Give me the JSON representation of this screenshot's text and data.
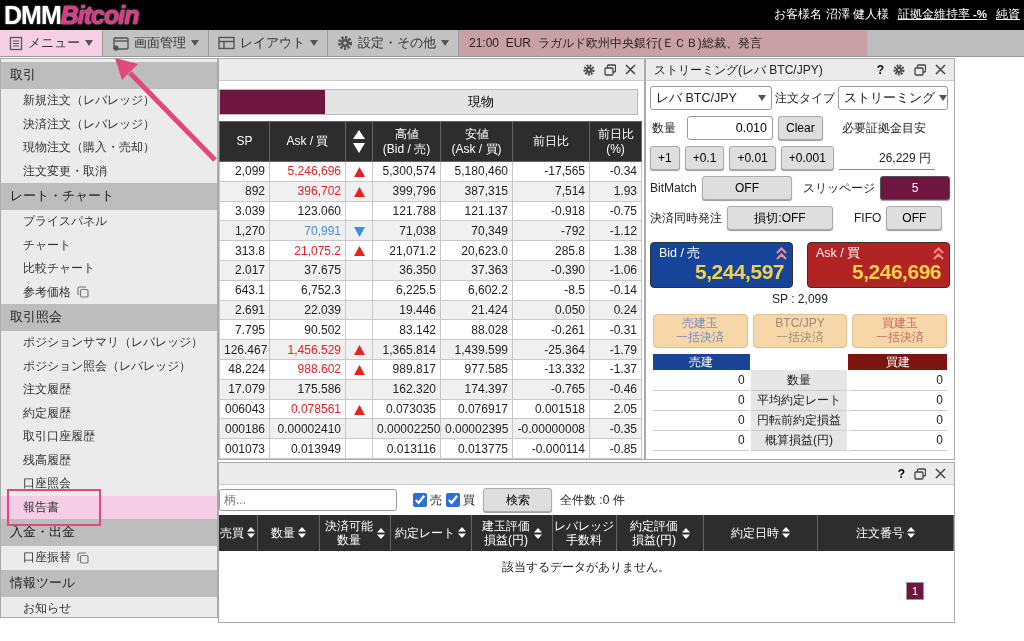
{
  "header": {
    "logo": {
      "main": "DMM",
      "accent": "Bitcoin"
    },
    "customer": "お客様名 沼澤 健人様",
    "links": [
      "証拠金維持率 **-%**",
      "純資"
    ]
  },
  "toolbar": {
    "menus": [
      {
        "label": "メニュー",
        "kind": "list",
        "selected": true
      },
      {
        "label": "画面管理",
        "kind": "window",
        "selected": false
      },
      {
        "label": "レイアウト",
        "kind": "layout",
        "selected": false
      },
      {
        "label": "設定・その他",
        "kind": "gear",
        "selected": false
      }
    ],
    "news": "21:00  EUR  ラガルド欧州中央銀行(ＥＣＢ)総裁、発言"
  },
  "menu": {
    "sections": [
      {
        "title": "取引",
        "items": [
          {
            "label": "新規注文（レバレッジ）",
            "external": false,
            "selected": false,
            "annotated": false
          },
          {
            "label": "決済注文（レバレッジ）",
            "external": false,
            "selected": false,
            "annotated": false
          },
          {
            "label": "現物注文（購入・売却）",
            "external": false,
            "selected": false,
            "annotated": false
          },
          {
            "label": "注文変更・取消",
            "external": false,
            "selected": false,
            "annotated": false
          }
        ]
      },
      {
        "title": "レート・チャート",
        "items": [
          {
            "label": "プライスパネル",
            "external": false,
            "selected": false,
            "annotated": false
          },
          {
            "label": "チャート",
            "external": false,
            "selected": false,
            "annotated": false
          },
          {
            "label": "比較チャート",
            "external": false,
            "selected": false,
            "annotated": false
          },
          {
            "label": "参考価格",
            "external": true,
            "selected": false,
            "annotated": false
          }
        ]
      },
      {
        "title": "取引照会",
        "items": [
          {
            "label": "ポジションサマリ（レバレッジ）",
            "external": false,
            "selected": false,
            "annotated": false
          },
          {
            "label": "ポジション照会（レバレッジ）",
            "external": false,
            "selected": false,
            "annotated": false
          },
          {
            "label": "注文履歴",
            "external": false,
            "selected": false,
            "annotated": false
          },
          {
            "label": "約定履歴",
            "external": false,
            "selected": false,
            "annotated": false
          },
          {
            "label": "取引口座履歴",
            "external": false,
            "selected": false,
            "annotated": false
          },
          {
            "label": "残高履歴",
            "external": false,
            "selected": false,
            "annotated": false
          },
          {
            "label": "口座照会",
            "external": false,
            "selected": false,
            "annotated": false
          },
          {
            "label": "報告書",
            "external": false,
            "selected": true,
            "annotated": true
          }
        ]
      },
      {
        "title": "入金・出金",
        "items": [
          {
            "label": "口座振替",
            "external": true,
            "selected": false,
            "annotated": false
          }
        ]
      },
      {
        "title": "情報ツール",
        "items": [
          {
            "label": "お知らせ",
            "external": false,
            "selected": false,
            "annotated": false
          }
        ]
      }
    ]
  },
  "rate_panel": {
    "tabs": [
      {
        "selected": true
      },
      {
        "label": "現物",
        "selected": false
      }
    ],
    "columns": [
      "SP",
      "Ask / 買",
      "高値\n(Bid / 売)",
      "安値\n(Ask / 買)",
      "前日比",
      "前日比\n(%)"
    ],
    "rows": [
      {
        "sp": "2,099",
        "ask": "5,246,696",
        "kind": "up",
        "high": "5,300,574",
        "low": "5,180,460",
        "change": "-17,565",
        "pct": "-0.34"
      },
      {
        "sp": "892",
        "ask": "396,702",
        "kind": "up",
        "high": "399,796",
        "low": "387,315",
        "change": "7,514",
        "pct": "1.93"
      },
      {
        "sp": "3.039",
        "ask": "123.060",
        "kind": "flat",
        "high": "121.788",
        "low": "121.137",
        "change": "-0.918",
        "pct": "-0.75"
      },
      {
        "sp": "1,270",
        "ask": "70,991",
        "kind": "down",
        "high": "71,038",
        "low": "70,349",
        "change": "-792",
        "pct": "-1.12"
      },
      {
        "sp": "313.8",
        "ask": "21,075.2",
        "kind": "up",
        "high": "21,071.2",
        "low": "20,623.0",
        "change": "285.8",
        "pct": "1.38"
      },
      {
        "sp": "2.017",
        "ask": "37.675",
        "kind": "flat",
        "high": "36.350",
        "low": "37.363",
        "change": "-0.390",
        "pct": "-1.06"
      },
      {
        "sp": "643.1",
        "ask": "6,752.3",
        "kind": "flat",
        "high": "6,225.5",
        "low": "6,602.2",
        "change": "-8.5",
        "pct": "-0.14"
      },
      {
        "sp": "2.691",
        "ask": "22.039",
        "kind": "flat",
        "high": "19.446",
        "low": "21.424",
        "change": "0.050",
        "pct": "0.24"
      },
      {
        "sp": "7.795",
        "ask": "90.502",
        "kind": "flat",
        "high": "83.142",
        "low": "88.028",
        "change": "-0.261",
        "pct": "-0.31"
      },
      {
        "sp": "126.467",
        "ask": "1,456.529",
        "kind": "up",
        "high": "1,365.814",
        "low": "1,439.599",
        "change": "-25.364",
        "pct": "-1.79"
      },
      {
        "sp": "48.224",
        "ask": "988.602",
        "kind": "up",
        "high": "989.817",
        "low": "977.585",
        "change": "-13.332",
        "pct": "-1.37"
      },
      {
        "sp": "17.079",
        "ask": "175.586",
        "kind": "flat",
        "high": "162.320",
        "low": "174.397",
        "change": "-0.765",
        "pct": "-0.46"
      },
      {
        "sp": "006043",
        "ask": "0.078561",
        "kind": "up",
        "high": "0.073035",
        "low": "0.076917",
        "change": "0.001518",
        "pct": "2.05"
      },
      {
        "sp": "000186",
        "ask": "0.00002410",
        "kind": "flat",
        "high": "0.00002250",
        "low": "0.00002395",
        "change": "-0.00000008",
        "pct": "-0.35"
      },
      {
        "sp": "001073",
        "ask": "0.013949",
        "kind": "flat",
        "high": "0.013116",
        "low": "0.013775",
        "change": "-0.000114",
        "pct": "-0.85"
      }
    ]
  },
  "streaming": {
    "title": "ストリーミング(レバ BTC/JPY)",
    "help": "?",
    "symbol": "レバ BTC/JPY",
    "order_type_label": "注文タイプ",
    "order_type": "ストリーミング",
    "quantity_label": "数量",
    "quantity": "0.010",
    "clear": "Clear",
    "margin_label": "必要証拠金目安",
    "increments": [
      "+1",
      "+0.1",
      "+0.01",
      "+0.001"
    ],
    "margin_value": "26,229 円",
    "bitmatch_label": "BitMatch",
    "bitmatch": "OFF",
    "slippage_label": "スリッページ",
    "slippage": "5",
    "settle_label": "決済同時発注",
    "settle": "損切:OFF",
    "fifo_label": "FIFO",
    "fifo": "OFF",
    "bid": {
      "label": "Bid / 売",
      "price": "5,244,597"
    },
    "ask": {
      "label": "Ask / 買",
      "price": "5,246,696"
    },
    "spread": "SP : 2,099",
    "bulk_buttons": [
      {
        "kind": "sell",
        "lines": [
          "売建玉",
          "一括決済"
        ],
        "disabled": true
      },
      {
        "kind": "all",
        "lines": [
          "BTC/JPY",
          "一括決済"
        ],
        "disabled": true
      },
      {
        "kind": "buy",
        "lines": [
          "買建玉",
          "一括決済"
        ],
        "disabled": true
      }
    ],
    "positions": {
      "sell_header": "売建",
      "buy_header": "買建",
      "rows": [
        {
          "sell": "0",
          "label": "数量",
          "buy": "0"
        },
        {
          "sell": "0",
          "label": "平均約定レート",
          "buy": "0"
        },
        {
          "sell": "0",
          "label": "円転前約定損益",
          "buy": "0"
        },
        {
          "sell": "0",
          "label": "概算損益(円)",
          "buy": "0"
        }
      ]
    }
  },
  "orders_panel": {
    "help": "?",
    "search": {
      "placeholder": "柄..."
    },
    "checkboxes": [
      {
        "label": "売",
        "checked": true
      },
      {
        "label": "買",
        "checked": true
      }
    ],
    "search_button": "検索",
    "count": "全件数 :0 件",
    "columns": [
      "売買",
      "数量",
      "決済可能数量",
      "約定レート",
      "建玉評価損益(円)",
      "レバレッジ手数料",
      "約定評価損益(円)",
      "約定日時",
      "注文番号"
    ],
    "sortable": [
      true,
      true,
      true,
      true,
      true,
      false,
      true,
      true,
      true
    ],
    "empty_message": "該当するデータがありません。",
    "pages": [
      {
        "label": "1",
        "selected": true
      }
    ]
  }
}
